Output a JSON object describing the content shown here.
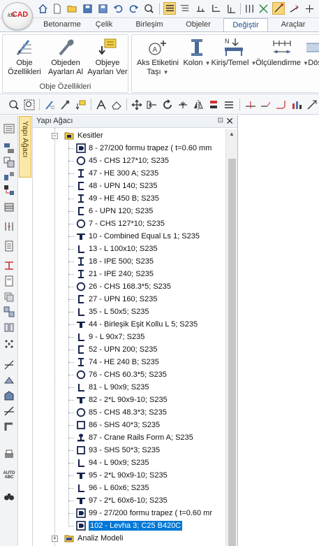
{
  "app": {
    "logo_text_small": "ide",
    "logo_text": "CAD"
  },
  "ribbon_tabs": [
    "Betonarme",
    "Çelik",
    "Birleşim",
    "Objeler",
    "Değiştir",
    "Araçlar"
  ],
  "active_tab": "Değiştir",
  "ribbon": {
    "group1_title": "Obje Özellikleri",
    "buttons": [
      {
        "line1": "Obje",
        "line2": "Özellikleri"
      },
      {
        "line1": "Objeden",
        "line2": "Ayarları Al"
      },
      {
        "line1": "Objeye",
        "line2": "Ayarları Ver"
      },
      {
        "line1": "Aks Etiketini",
        "line2": "Taşı"
      },
      {
        "line1": "Kolon",
        "line2": ""
      },
      {
        "line1": "Kiriş/Temel",
        "line2": ""
      },
      {
        "line1": "Ölçülendirme",
        "line2": ""
      },
      {
        "line1": "Döş",
        "line2": ""
      }
    ]
  },
  "side_tab_label": "Yapı Ağacı",
  "panel": {
    "title": "Yapı Ağacı",
    "pin": "⊡",
    "close": "✕"
  },
  "tree": {
    "folder_label": "Kesitler",
    "bottom_folder_label": "Analiz Modeli",
    "items": [
      {
        "icon": "plate",
        "label": "8 - 27/200 formu trapez ( t=0.60 mm"
      },
      {
        "icon": "circle",
        "label": "45 - CHS 127*10; S235"
      },
      {
        "icon": "ibeam",
        "label": "47 - HE 300 A; S235"
      },
      {
        "icon": "channel",
        "label": "48 - UPN 140; S235"
      },
      {
        "icon": "ibeam",
        "label": "49 - HE 450 B; S235"
      },
      {
        "icon": "channel",
        "label": "6 - UPN 120; S235"
      },
      {
        "icon": "circle",
        "label": "7 - CHS 127*10; S235"
      },
      {
        "icon": "double-angle",
        "label": "10 - Combined Equal Ls 1; S235"
      },
      {
        "icon": "angle",
        "label": "13 - L 100x10; S235"
      },
      {
        "icon": "ibeam",
        "label": "18 - IPE 500; S235"
      },
      {
        "icon": "ibeam",
        "label": "21 - IPE 240; S235"
      },
      {
        "icon": "circle",
        "label": "26 - CHS 168.3*5; S235"
      },
      {
        "icon": "channel",
        "label": "27 - UPN 160; S235"
      },
      {
        "icon": "angle",
        "label": "35 - L 50x5; S235"
      },
      {
        "icon": "double-angle",
        "label": "44 - Birleşik Eşit Kollu L 5; S235"
      },
      {
        "icon": "angle",
        "label": "9 - L 90x7; S235"
      },
      {
        "icon": "channel",
        "label": "52 - UPN 200; S235"
      },
      {
        "icon": "ibeam",
        "label": "74 - HE 240 B; S235"
      },
      {
        "icon": "circle",
        "label": "76 - CHS 60.3*5; S235"
      },
      {
        "icon": "angle",
        "label": "81 - L 90x9; S235"
      },
      {
        "icon": "double-angle",
        "label": "82 - 2*L 90x9-10; S235"
      },
      {
        "icon": "circle",
        "label": "85 - CHS 48.3*3; S235"
      },
      {
        "icon": "square",
        "label": "86 - SHS 40*3; S235"
      },
      {
        "icon": "rail",
        "label": "87 - Crane Rails Form A; S235"
      },
      {
        "icon": "square",
        "label": "93 - SHS 50*3; S235"
      },
      {
        "icon": "angle",
        "label": "94 - L 90x9; S235"
      },
      {
        "icon": "double-angle",
        "label": "95 - 2*L 90x9-10; S235"
      },
      {
        "icon": "angle",
        "label": "96 - L 60x6; S235"
      },
      {
        "icon": "double-angle",
        "label": "97 - 2*L 60x6-10; S235"
      },
      {
        "icon": "plate",
        "label": "99 - 27/200 formu trapez ( t=0.60 mr"
      },
      {
        "icon": "plate",
        "label": "102 - Levha 3; C25 B420C",
        "selected": true
      }
    ]
  },
  "colors": {
    "accent": "#1d4f91",
    "selection": "#0078d7",
    "sidetab": "#fbe8a6",
    "logo_red": "#d71920"
  }
}
